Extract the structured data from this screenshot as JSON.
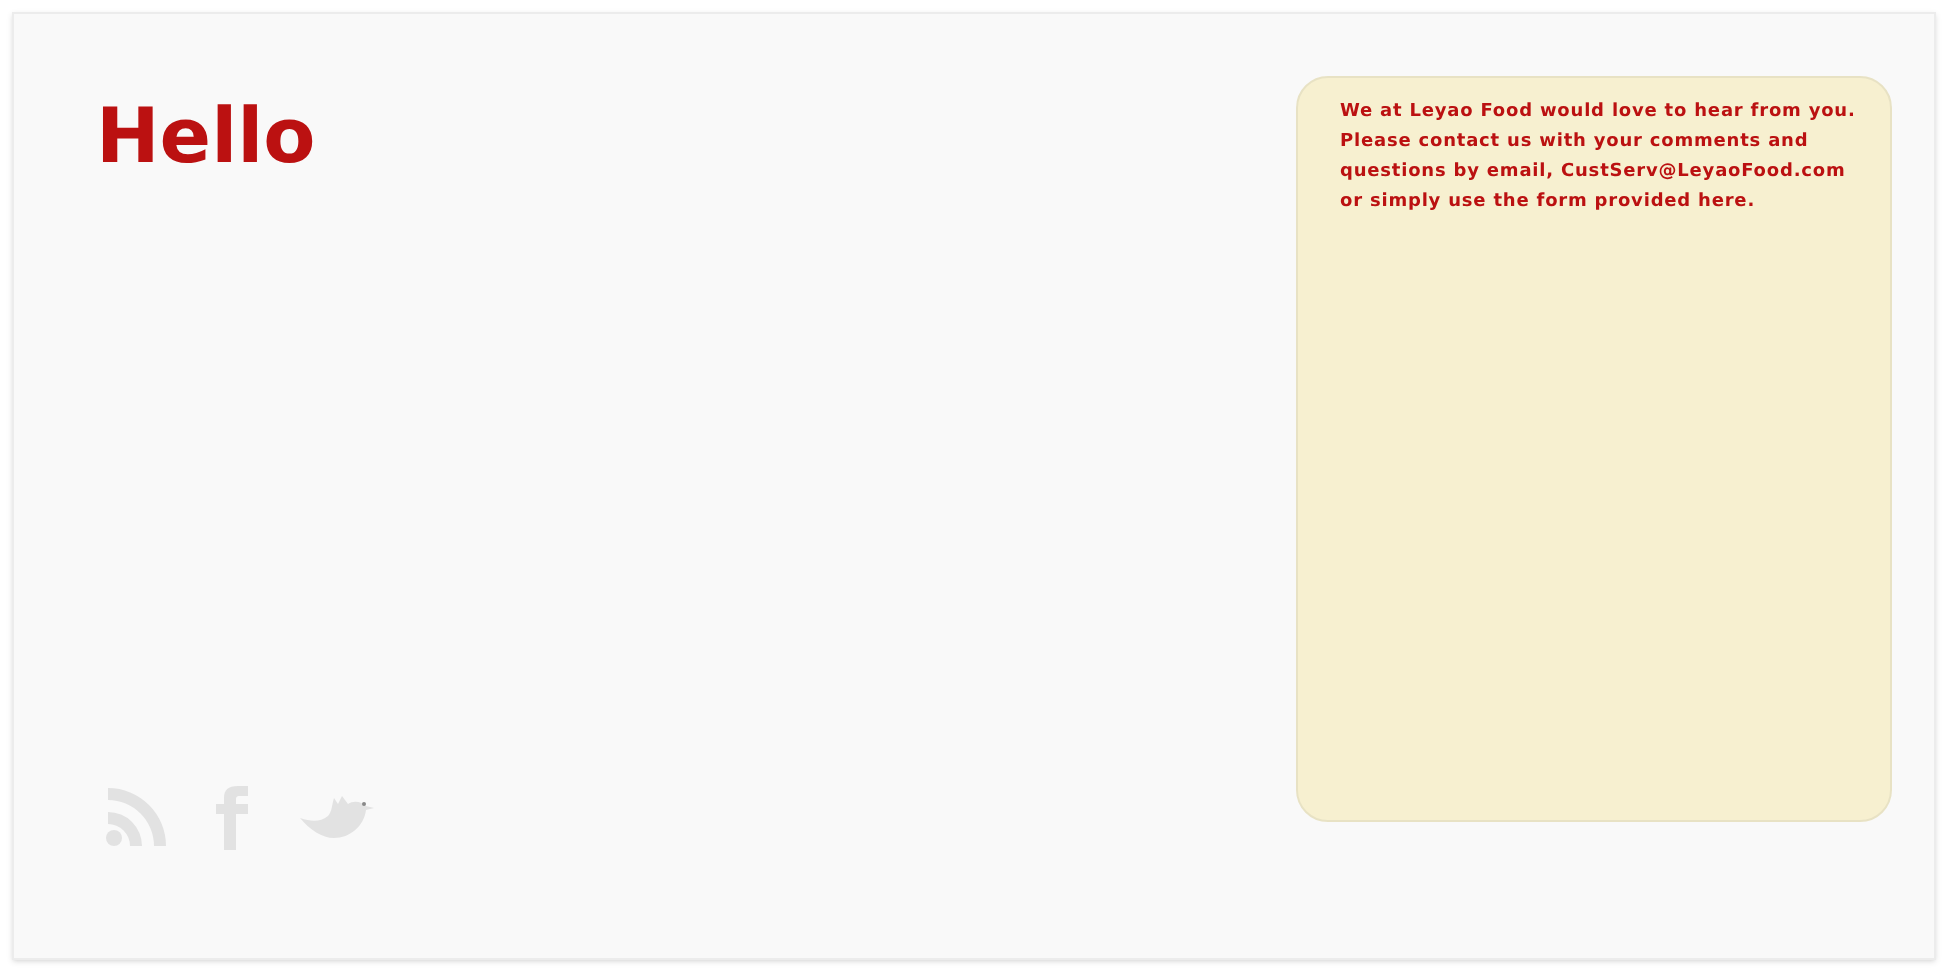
{
  "heading": "Hello",
  "contact_note": "We at Leyao Food would love to hear from you. Please contact us with your comments and questions by email, CustServ@LeyaoFood.com or simply use the form provided here.",
  "social_links": [
    {
      "kind": "rss"
    },
    {
      "kind": "facebook"
    },
    {
      "kind": "bird"
    }
  ]
}
